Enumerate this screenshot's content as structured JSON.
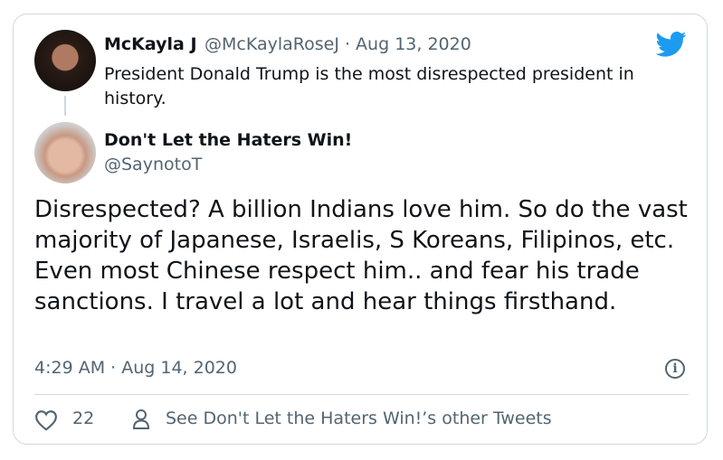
{
  "colors": {
    "accent": "#1d9bf0",
    "text": "#0f1419",
    "muted": "#536471",
    "border": "#cfd9de"
  },
  "quoted_tweet": {
    "display_name": "McKayla J",
    "meta": "@McKaylaRoseJ · Aug 13, 2020",
    "text": "President Donald Trump is the most disrespected president in history."
  },
  "main_tweet": {
    "display_name": "Don't Let the Haters Win!",
    "handle": "@SaynotoT",
    "text": "Disrespected? A billion Indians love him. So do the vast majority of Japanese, Israelis, S Koreans, Filipinos, etc. Even most Chinese respect him.. and fear his trade sanctions. I travel a lot and hear things firsthand.",
    "timestamp": "4:29 AM · Aug 14, 2020"
  },
  "footer": {
    "like_count": "22",
    "other_tweets_label": "See Don't Let the Haters Win!’s other Tweets"
  },
  "icons": {
    "bird": "twitter-bird-icon",
    "info": "info-icon",
    "heart": "heart-icon",
    "person": "person-icon"
  }
}
